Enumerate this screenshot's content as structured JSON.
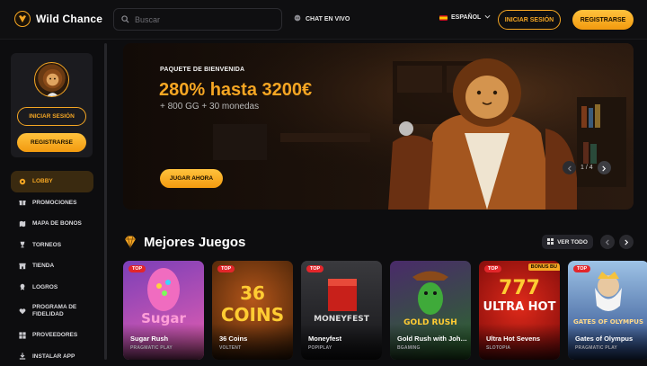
{
  "brand": {
    "name": "Wild Chance"
  },
  "header": {
    "search_placeholder": "Buscar",
    "chat_label": "CHAT EN VIVO",
    "language": "ESPAÑOL",
    "login_label": "INICIAR SESIÓN",
    "register_label": "REGISTRARSE"
  },
  "sidebar": {
    "login_label": "INICIAR SESIÓN",
    "register_label": "REGISTRARSE",
    "items": [
      {
        "label": "LOBBY",
        "icon": "lobby-icon",
        "active": true
      },
      {
        "label": "PROMOCIONES",
        "icon": "gift-icon"
      },
      {
        "label": "MAPA DE BONOS",
        "icon": "map-icon"
      },
      {
        "label": "TORNEOS",
        "icon": "trophy-icon"
      },
      {
        "label": "TIENDA",
        "icon": "store-icon"
      },
      {
        "label": "LOGROS",
        "icon": "achievement-icon"
      },
      {
        "label": "PROGRAMA DE FIDELIDAD",
        "icon": "loyalty-icon"
      },
      {
        "label": "PROVEEDORES",
        "icon": "providers-icon"
      },
      {
        "label": "INSTALAR APP",
        "icon": "download-icon"
      }
    ]
  },
  "banner": {
    "subtitle": "PAQUETE DE BIENVENIDA",
    "headline": "280% hasta 3200€",
    "detail": "+ 800 GG + 30 monedas",
    "cta_label": "JUGAR AHORA",
    "page": "1 / 4"
  },
  "section": {
    "title": "Mejores Juegos",
    "view_all_label": "VER TODO"
  },
  "games": [
    {
      "name": "Sugar Rush",
      "provider": "PRAGMATIC PLAY",
      "badge": "TOP",
      "art_text": "Sugar",
      "color_a": "#7b3fb8",
      "color_b": "#e85fb0"
    },
    {
      "name": "36 Coins",
      "provider": "VOLTENT",
      "badge": "TOP",
      "art_text": "36 COINS",
      "color_a": "#3a1d06",
      "color_b": "#b5561a"
    },
    {
      "name": "Moneyfest",
      "provider": "POPIPLAY",
      "badge": "TOP",
      "art_text": "MONEYFEST",
      "color_a": "#3a3a3e",
      "color_b": "#151518"
    },
    {
      "name": "Gold Rush with Johnny Cash",
      "provider": "BGAMING",
      "badge": "",
      "art_text": "GOLD RUSH",
      "color_a": "#4a2a6a",
      "color_b": "#2a6a2a"
    },
    {
      "name": "Ultra Hot Sevens",
      "provider": "SLOTOPIA",
      "badge": "TOP",
      "bonus": "BONUS BU",
      "art_text": "ULTRA HOT",
      "color_a": "#7a0a0a",
      "color_b": "#e02a1a"
    },
    {
      "name": "Gates of Olympus",
      "provider": "PRAGMATIC PLAY",
      "badge": "TOP",
      "art_text": "GATES OF OLYMPUS",
      "color_a": "#2a4a8a",
      "color_b": "#9ec3e6"
    }
  ],
  "colors": {
    "accent": "#f5a623",
    "background": "#0d0d0f",
    "badge_red": "#e3262b"
  }
}
